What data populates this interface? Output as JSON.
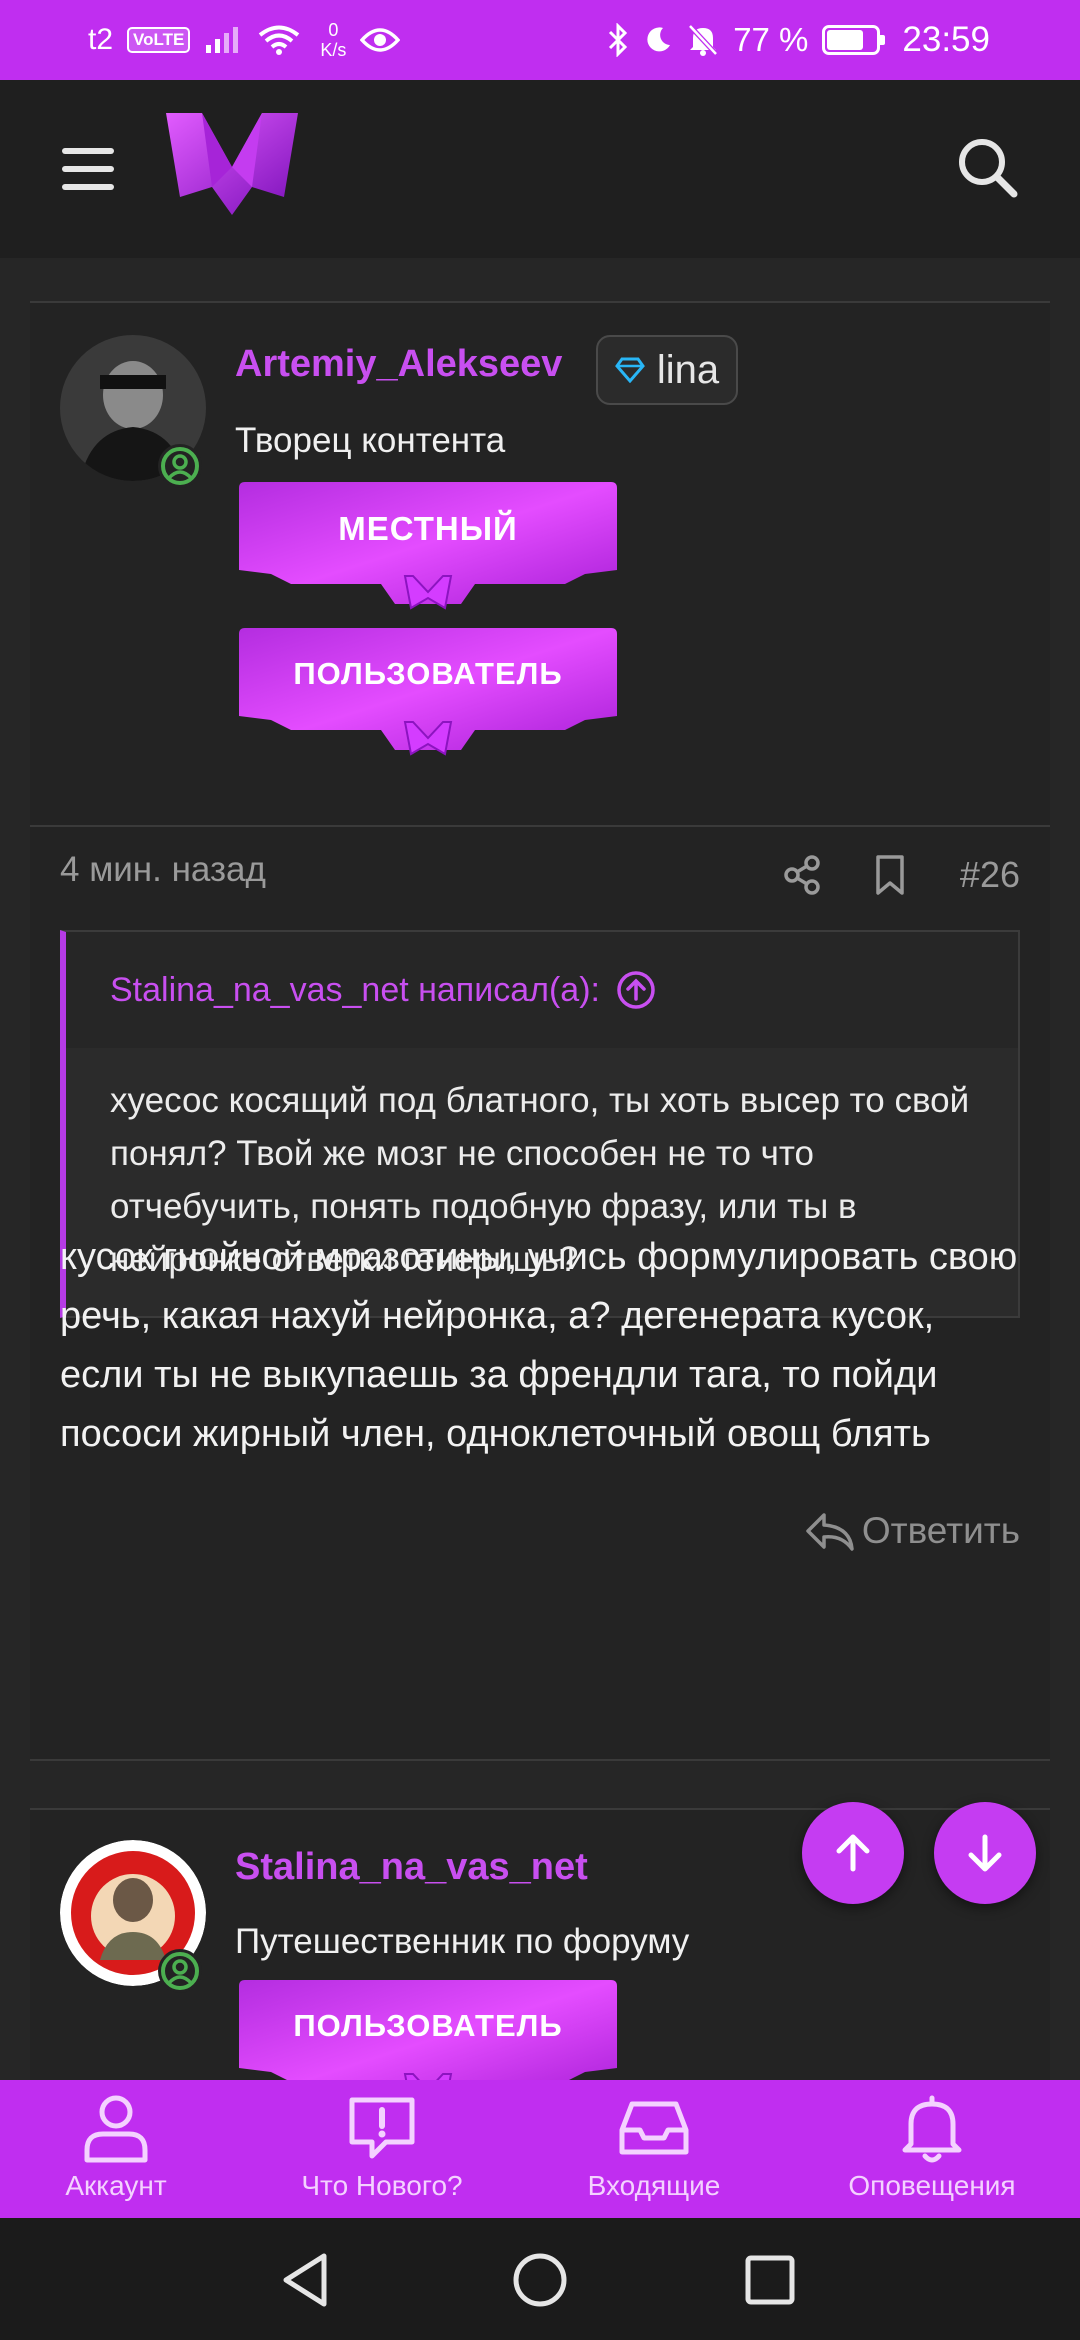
{
  "status_bar": {
    "carrier": "t2",
    "volte": "VoLTE",
    "speed_value": "0",
    "speed_unit": "K/s",
    "battery_text": "77 %",
    "battery_level": 0.77,
    "time": "23:59"
  },
  "colors": {
    "accent": "#c02ef0",
    "username": "#c84ff0",
    "background": "#262626"
  },
  "header": {
    "menu_icon": "hamburger-menu-icon",
    "logo_icon": "m-logo",
    "search_icon": "search-icon"
  },
  "post1": {
    "username": "Artemiy_Alekseev",
    "badge": "lina",
    "user_title": "Творец контента",
    "banners": [
      {
        "text": "МЕСТНЫЙ"
      },
      {
        "text": "ПОЛЬЗОВАТЕЛЬ"
      }
    ],
    "time": "4 мин. назад",
    "post_number": "#26",
    "quote_author": "Stalina_na_vas_net написал(а):",
    "quote_text": "хуесос косящий под блатного, ты хоть высер то свой понял? Твой же мозг не способен не то что отчебучить, понять подобную фразу, или ты в нейронке ответки генеришь?",
    "body": "кусок гнойной мразотины, учись формулировать свою речь, какая нахуй нейронка, а? дегенерата кусок, если ты не выкупаешь за френдли тага, то пойди пососи жирный член, одноклеточный овощ блять",
    "reply_label": "Ответить"
  },
  "post2": {
    "username": "Stalina_na_vas_net",
    "user_title": "Путешественник по форуму",
    "banner": "ПОЛЬЗОВАТЕЛЬ"
  },
  "bottom_nav": [
    {
      "label": "Аккаунт",
      "icon": "user-icon"
    },
    {
      "label": "Что Нового?",
      "icon": "alert-bubble-icon"
    },
    {
      "label": "Входящие",
      "icon": "inbox-icon"
    },
    {
      "label": "Оповещения",
      "icon": "bell-icon"
    }
  ]
}
